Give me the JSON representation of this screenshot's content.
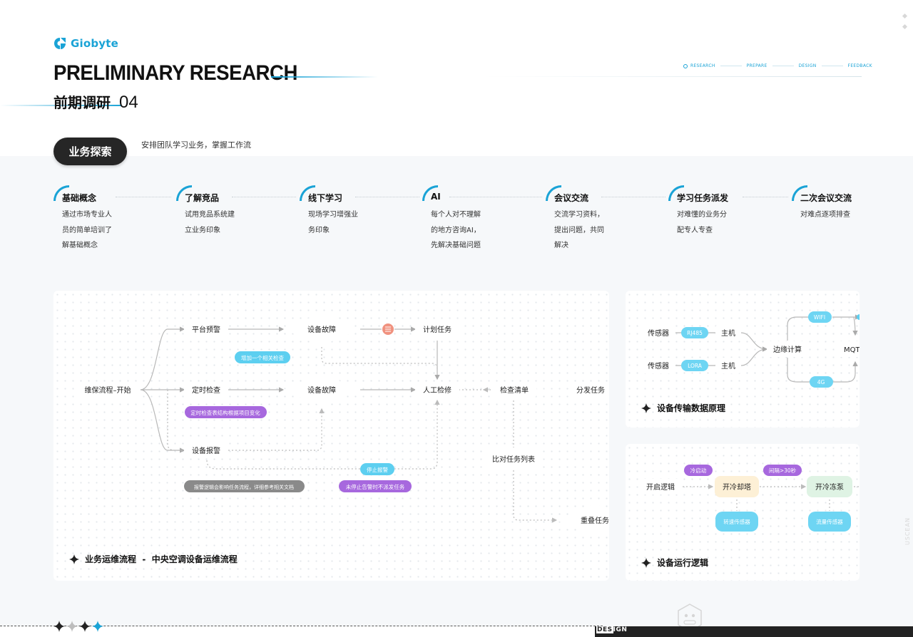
{
  "brand": {
    "logo_text": "Giobyte",
    "accent": "#1aa3d6"
  },
  "header": {
    "title_en": "PRELIMINARY RESEARCH",
    "title_cn": "前期调研",
    "title_num": "04",
    "nav_steps": [
      "RESEARCH",
      "PREPARE",
      "DESIGN",
      "FEEDBACK"
    ],
    "active_step": "RESEARCH"
  },
  "section": {
    "pill_label": "业务探索",
    "subtitle": "安排团队学习业务，掌握工作流"
  },
  "process": [
    {
      "title": "基础概念",
      "desc": [
        "通过市场专业人",
        "员的简单培训了",
        "解基础概念"
      ]
    },
    {
      "title": "了解竞品",
      "desc": [
        "试用竞品系统建",
        "立业务印象"
      ]
    },
    {
      "title": "线下学习",
      "desc": [
        "现场学习增强业",
        "务印象"
      ]
    },
    {
      "title": "AI",
      "desc": [
        "每个人对不理解",
        "的地方咨询AI，",
        "先解决基础问题"
      ]
    },
    {
      "title": "会议交流",
      "desc": [
        "交流学习资料，",
        "提出问题，共同",
        "解决"
      ]
    },
    {
      "title": "学习任务派发",
      "desc": [
        "对难懂的业务分",
        "配专人专查"
      ]
    },
    {
      "title": "二次会议交流",
      "desc": [
        "对难点逐项排查"
      ]
    }
  ],
  "flow_main": {
    "caption": "业务运维流程  -  中央空调设备运维流程",
    "nodes": {
      "start": "维保流程–开始",
      "platform_alert": "平台预警",
      "scheduled_check": "定时检查",
      "device_alarm": "设备报警",
      "fault_1": "设备故障",
      "fault_2": "设备故障",
      "plan_task": "计划任务",
      "manual_repair": "人工检修",
      "checklist": "检查清单",
      "dispatch": "分发任务",
      "compare_list": "比对任务列表",
      "duplicate": "重叠任务"
    },
    "tags": {
      "add_check": "增加一个相关检查",
      "checklist_change": "定时检查表结构根据项目变化",
      "stop_alarm": "停止报警",
      "alarm_logic": "报警逻辑会影响任务流程，详细参考相关文档",
      "no_dispatch": "未停止告警时不派发任务"
    },
    "colors": {
      "blue_tag": "#5dcff0",
      "purple_tag": "#a768de",
      "gray_tag": "#8a8a8a",
      "red_dot": "#f0927f"
    }
  },
  "flow_transmit": {
    "caption": "设备传输数据原理",
    "nodes": {
      "sensor_1": "传感器",
      "sensor_2": "传感器",
      "host_1": "主机",
      "host_2": "主机",
      "edge": "边缘计算",
      "mqtt": "MQTT"
    },
    "tags": {
      "rj485": "RJ485",
      "lora": "LORA",
      "wifi": "WIFI",
      "g4": "4G"
    }
  },
  "flow_logic": {
    "caption": "设备运行逻辑",
    "nodes": {
      "open_logic": "开启逻辑",
      "cool_tower": "开冷却塔",
      "cool_pump": "开冷冻泵"
    },
    "tags": {
      "cold_start": "冷启动",
      "interval": "间隔>30秒",
      "speed_sensor": "转速传感器",
      "flow_sensor": "流量传感器"
    }
  },
  "footer": {
    "design_prefix": "DES",
    "design_suffix": "IGN",
    "side_mark": "USCEAN"
  }
}
